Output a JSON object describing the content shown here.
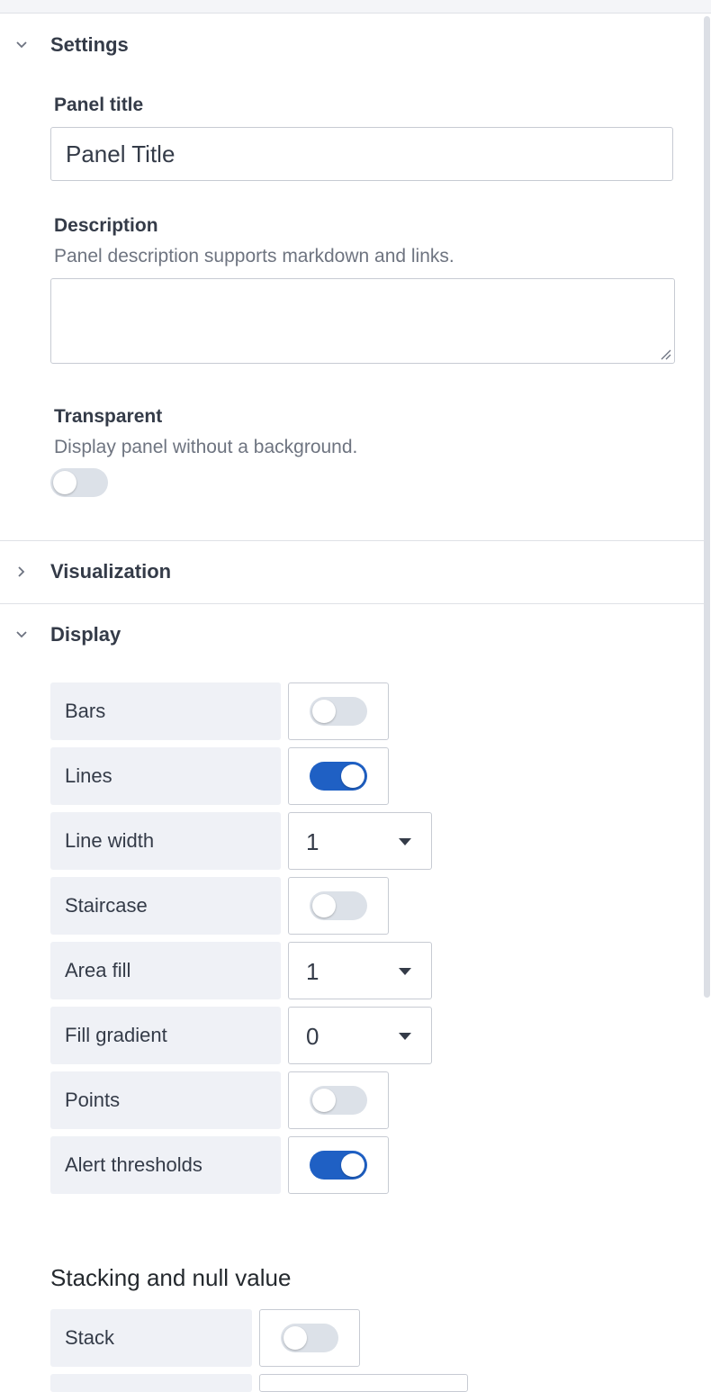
{
  "settings": {
    "title": "Settings",
    "panel_title_label": "Panel title",
    "panel_title_value": "Panel Title",
    "description_label": "Description",
    "description_help": "Panel description supports markdown and links.",
    "description_value": "",
    "transparent_label": "Transparent",
    "transparent_help": "Display panel without a background.",
    "transparent_on": false
  },
  "visualization": {
    "title": "Visualization"
  },
  "display": {
    "title": "Display",
    "rows": [
      {
        "label": "Bars",
        "type": "toggle",
        "on": false
      },
      {
        "label": "Lines",
        "type": "toggle",
        "on": true
      },
      {
        "label": "Line width",
        "type": "select",
        "value": "1"
      },
      {
        "label": "Staircase",
        "type": "toggle",
        "on": false
      },
      {
        "label": "Area fill",
        "type": "select",
        "value": "1"
      },
      {
        "label": "Fill gradient",
        "type": "select",
        "value": "0"
      },
      {
        "label": "Points",
        "type": "toggle",
        "on": false
      },
      {
        "label": "Alert thresholds",
        "type": "toggle",
        "on": true
      }
    ]
  },
  "stacking": {
    "heading": "Stacking and null value",
    "stack_label": "Stack",
    "stack_on": false
  },
  "colors": {
    "accent": "#1f60c4",
    "toggle_off": "#dce1e8",
    "label_bg": "#eff1f6",
    "border": "#c7cbd3"
  }
}
